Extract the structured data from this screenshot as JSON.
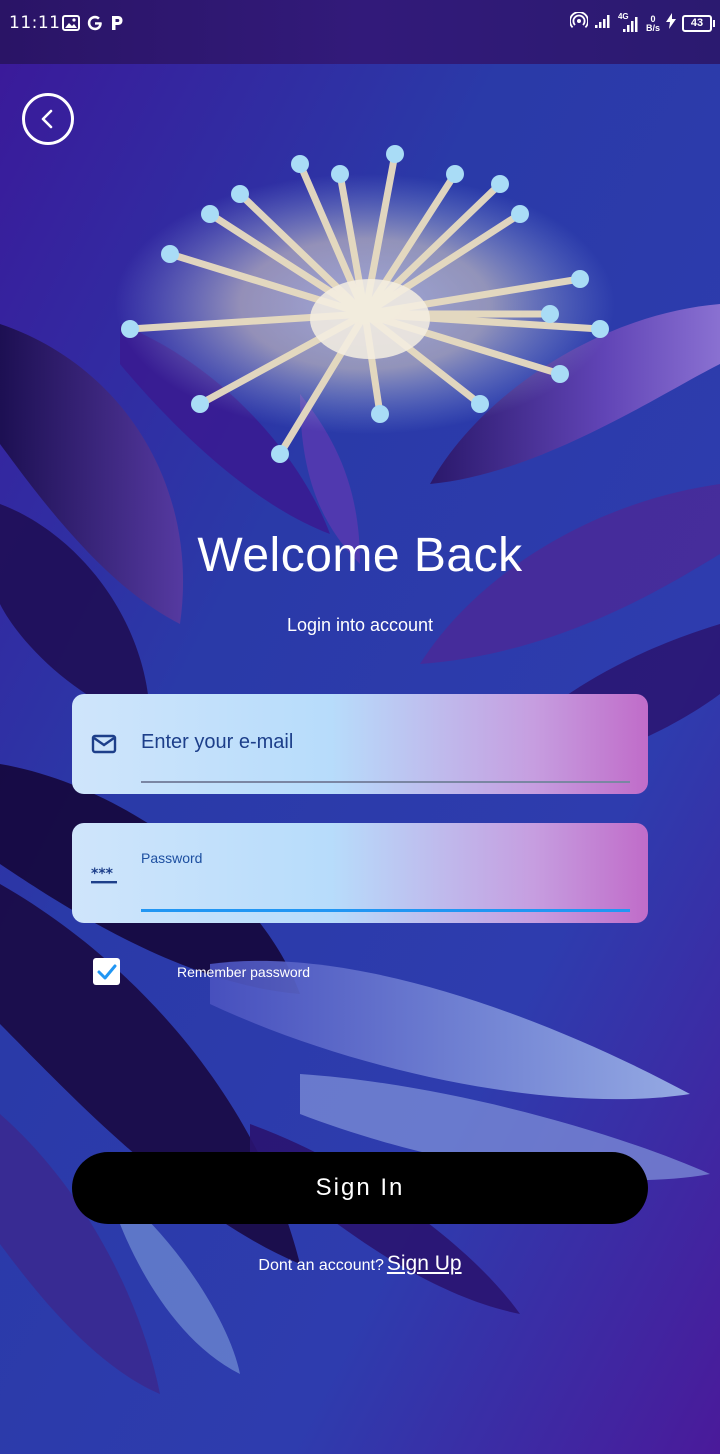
{
  "status_bar": {
    "time": "11:11",
    "left_icons": [
      "gallery-icon",
      "google-icon",
      "p-app-icon"
    ],
    "right_icons": [
      "hotspot-icon",
      "signal-icon",
      "signal-4g-icon",
      "net-speed",
      "charging-icon",
      "battery-icon"
    ],
    "network_type": "4G",
    "net_speed_value": "0",
    "net_speed_unit": "B/s",
    "battery_level": "43"
  },
  "header": {
    "back_icon": "chevron-left-icon"
  },
  "main": {
    "title": "Welcome Back",
    "subtitle": "Login into account",
    "email": {
      "icon": "mail-icon",
      "placeholder": "Enter your e-mail",
      "value": ""
    },
    "password": {
      "icon": "password-dots-icon",
      "label": "Password",
      "value": ""
    },
    "remember": {
      "checked": true,
      "label": "Remember password"
    },
    "sign_in_label": "Sign In",
    "signup_prompt": "Dont an account?",
    "signup_link": "Sign Up"
  },
  "colors": {
    "background_deep": "#2a1a7a",
    "background_blue": "#2f3fb0",
    "petal_purple": "#5a3aa8",
    "field_left": "#cfe5fb",
    "field_right": "#c06cc9",
    "field_text": "#1d3f8a",
    "focus_underline": "#2196f3",
    "checkbox_check": "#2196f3",
    "button_bg": "#000000",
    "text_white": "#ffffff"
  }
}
